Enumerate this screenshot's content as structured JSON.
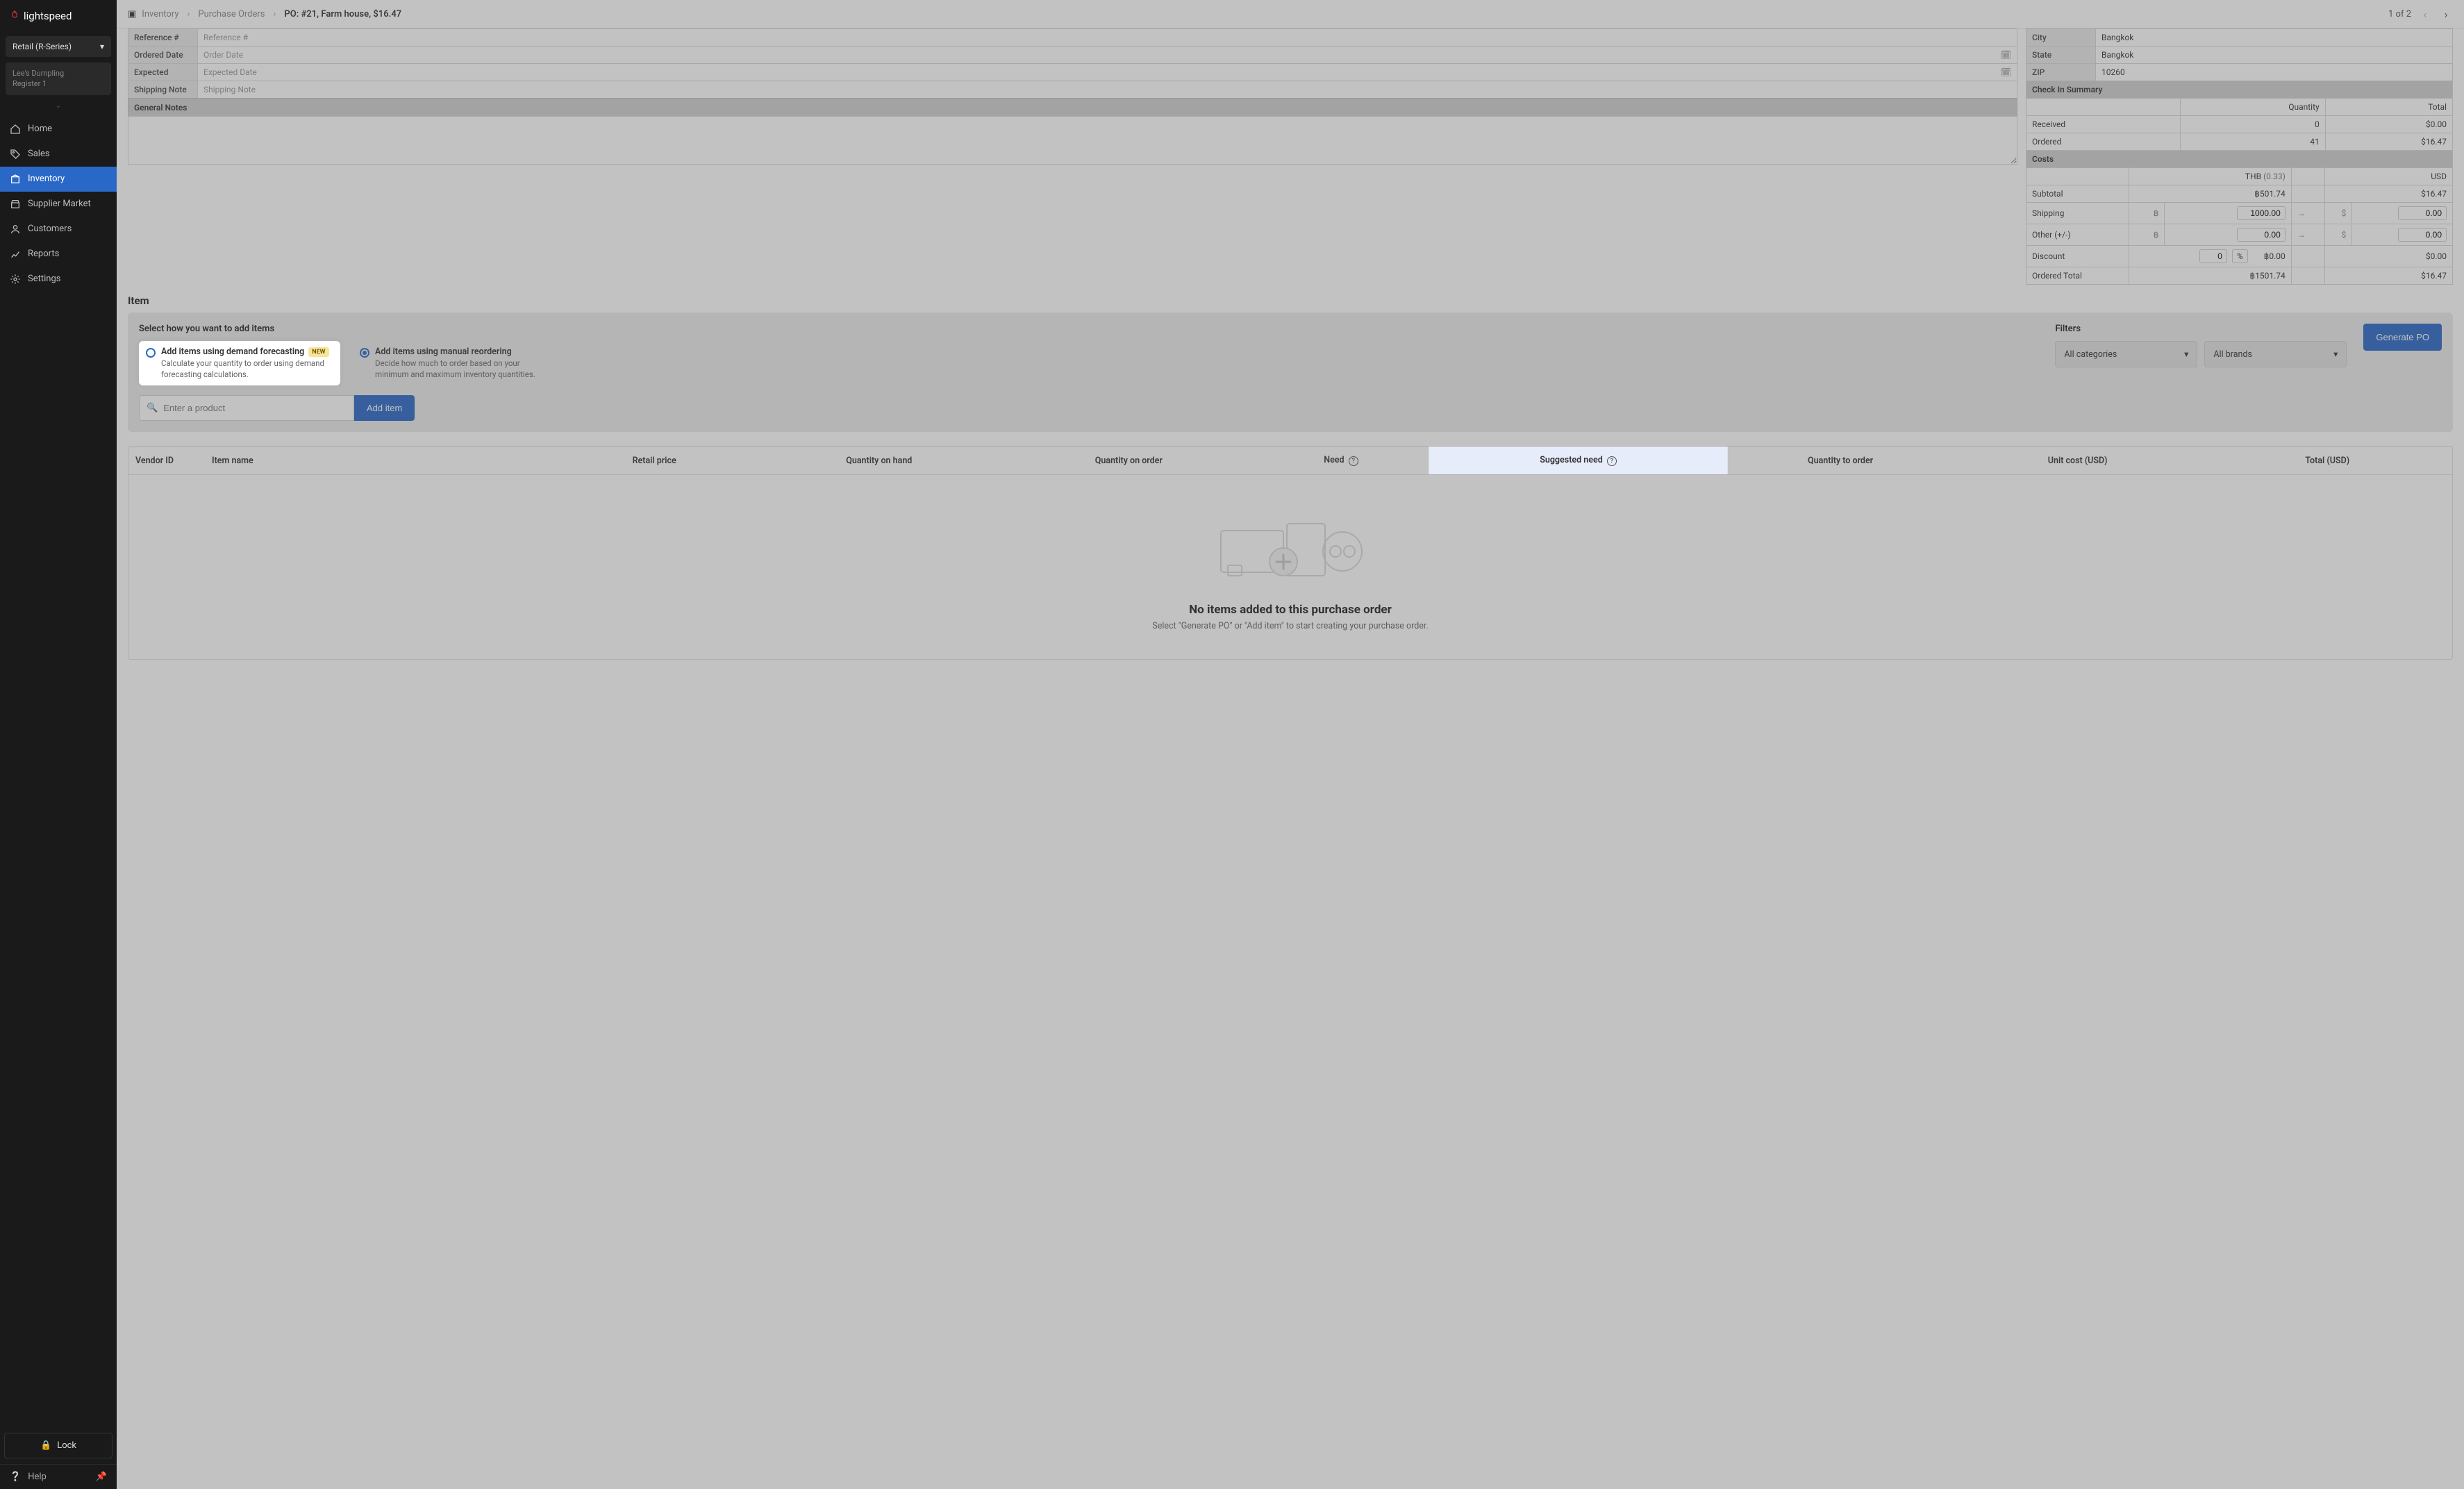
{
  "brand": "lightspeed",
  "shop_selector": "Retail (R-Series)",
  "store": {
    "name": "Lee's Dumpling",
    "register": "Register 1"
  },
  "nav": {
    "home": "Home",
    "sales": "Sales",
    "inventory": "Inventory",
    "supplier_market": "Supplier Market",
    "customers": "Customers",
    "reports": "Reports",
    "settings": "Settings"
  },
  "sidebar_footer": {
    "lock": "Lock",
    "help": "Help"
  },
  "breadcrumb": {
    "inventory": "Inventory",
    "purchase_orders": "Purchase Orders",
    "po_prefix": "PO:",
    "po_detail": "#21, Farm house, $16.47"
  },
  "pager": {
    "text": "1 of 2"
  },
  "left_form": {
    "reference_label": "Reference #",
    "reference_placeholder": "Reference #",
    "ordered_label": "Ordered Date",
    "ordered_placeholder": "Order Date",
    "expected_label": "Expected",
    "expected_placeholder": "Expected Date",
    "shipping_label": "Shipping Note",
    "shipping_placeholder": "Shipping Note",
    "general_notes": "General Notes"
  },
  "address": {
    "city_label": "City",
    "city": "Bangkok",
    "state_label": "State",
    "state": "Bangkok",
    "zip_label": "ZIP",
    "zip": "10260"
  },
  "checkin": {
    "header": "Check In Summary",
    "col_qty": "Quantity",
    "col_total": "Total",
    "received_label": "Received",
    "received_qty": "0",
    "received_total": "$0.00",
    "ordered_label": "Ordered",
    "ordered_qty": "41",
    "ordered_total": "$16.47"
  },
  "costs": {
    "header": "Costs",
    "thb": "THB",
    "rate": "(0.33)",
    "usd": "USD",
    "subtotal_label": "Subtotal",
    "subtotal_thb": "฿501.74",
    "subtotal_usd": "$16.47",
    "shipping_label": "Shipping",
    "shipping_thb": "1000.00",
    "shipping_usd": "0.00",
    "other_label": "Other (+/-)",
    "other_thb": "0.00",
    "other_usd": "0.00",
    "discount_label": "Discount",
    "discount_val": "0",
    "discount_unit": "%",
    "discount_thb": "฿0.00",
    "discount_usd": "$0.00",
    "ordered_total_label": "Ordered Total",
    "ordered_total_thb": "฿1501.74",
    "ordered_total_usd": "$16.47",
    "currency_thb_sym": "฿",
    "currency_usd_sym": "$"
  },
  "item_section": {
    "title": "Item",
    "select_how": "Select how you want to add items",
    "forecast_title": "Add items using demand forecasting",
    "forecast_badge": "NEW",
    "forecast_desc": "Calculate your quantity to order using demand forecasting calculations.",
    "manual_title": "Add items using manual reordering",
    "manual_desc": "Decide how much to order based on your minimum and maximum inventory quantities.",
    "filters": "Filters",
    "all_categories": "All categories",
    "all_brands": "All brands",
    "generate_po": "Generate PO",
    "search_placeholder": "Enter a product",
    "add_item": "Add item"
  },
  "items_table": {
    "vendor_id": "Vendor ID",
    "item_name": "Item name",
    "retail_price": "Retail price",
    "qty_on_hand": "Quantity on hand",
    "qty_on_order": "Quantity on order",
    "need": "Need",
    "suggested_need": "Suggested need",
    "qty_to_order": "Quantity to order",
    "unit_cost": "Unit cost (USD)",
    "total": "Total (USD)"
  },
  "empty_state": {
    "title": "No items added to this purchase order",
    "sub": "Select \"Generate PO\" or \"Add item\" to start creating your purchase order."
  }
}
